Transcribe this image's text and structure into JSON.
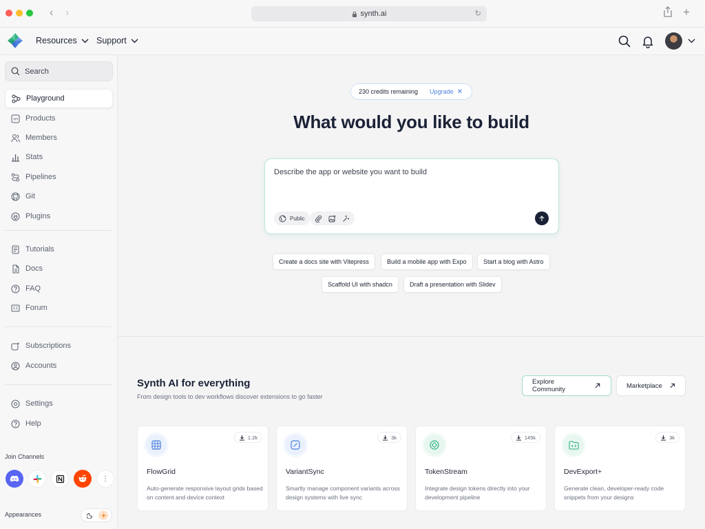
{
  "browser": {
    "url": "synth.ai"
  },
  "header": {
    "menus": [
      "Resources",
      "Support"
    ]
  },
  "sidebar": {
    "search_label": "Search",
    "items_top": [
      {
        "label": "Playground",
        "icon": "playground-icon",
        "active": true
      },
      {
        "label": "Products",
        "icon": "api-icon"
      },
      {
        "label": "Members",
        "icon": "users-icon"
      },
      {
        "label": "Stats",
        "icon": "bar-chart-icon"
      },
      {
        "label": "Pipelines",
        "icon": "pipeline-icon"
      },
      {
        "label": "Git",
        "icon": "github-icon"
      },
      {
        "label": "Plugins",
        "icon": "plug-icon"
      }
    ],
    "items_mid": [
      {
        "label": "Tutorials",
        "icon": "tutorial-icon"
      },
      {
        "label": "Docs",
        "icon": "doc-icon"
      },
      {
        "label": "FAQ",
        "icon": "question-icon"
      },
      {
        "label": "Forum",
        "icon": "forum-icon"
      }
    ],
    "items_low": [
      {
        "label": "Subscriptions",
        "icon": "subscription-icon"
      },
      {
        "label": "Accounts",
        "icon": "account-icon"
      }
    ],
    "items_bottom": [
      {
        "label": "Settings",
        "icon": "settings-icon"
      },
      {
        "label": "Help",
        "icon": "help-icon"
      }
    ],
    "channels_label": "Join Channels",
    "appearance_label": "Appearances"
  },
  "main": {
    "credits_text": "230 credits remaining",
    "upgrade_label": "Upgrade",
    "headline": "What would you like to build",
    "prompt_placeholder": "Describe the app or website you want to build",
    "visibility_label": "Public",
    "suggestions_row1": [
      "Create a docs site with Vitepress",
      "Build a mobile app with Expo",
      "Start a blog with Astro"
    ],
    "suggestions_row2": [
      "Scaffold UI with shadcn",
      "Draft a presentation with Slidev"
    ],
    "section_title": "Synth AI for everything",
    "section_subtitle": "From design tools to dev workflows discover extensions to go faster",
    "explore_label": "Explore Community",
    "marketplace_label": "Marketplace",
    "cards": [
      {
        "name": "FlowGrid",
        "downloads": "1.2k",
        "desc": "Auto-generate responsive layout grids based on content and device context",
        "icon": "grid-icon",
        "accent": "#4a7fdc"
      },
      {
        "name": "VariantSync",
        "downloads": "3k",
        "desc": "Smartly manage component variants across design systems with live sync",
        "icon": "variant-icon",
        "accent": "#4a7fdc"
      },
      {
        "name": "TokenStream",
        "downloads": "145k",
        "desc": "Integrate design tokens directly into your development pipeline",
        "icon": "token-icon",
        "accent": "#2fb27f"
      },
      {
        "name": "DevExport+",
        "downloads": "3k",
        "desc": "Generate clean, developer-ready code snippets from your designs",
        "icon": "code-folder-icon",
        "accent": "#2fb27f"
      }
    ]
  }
}
